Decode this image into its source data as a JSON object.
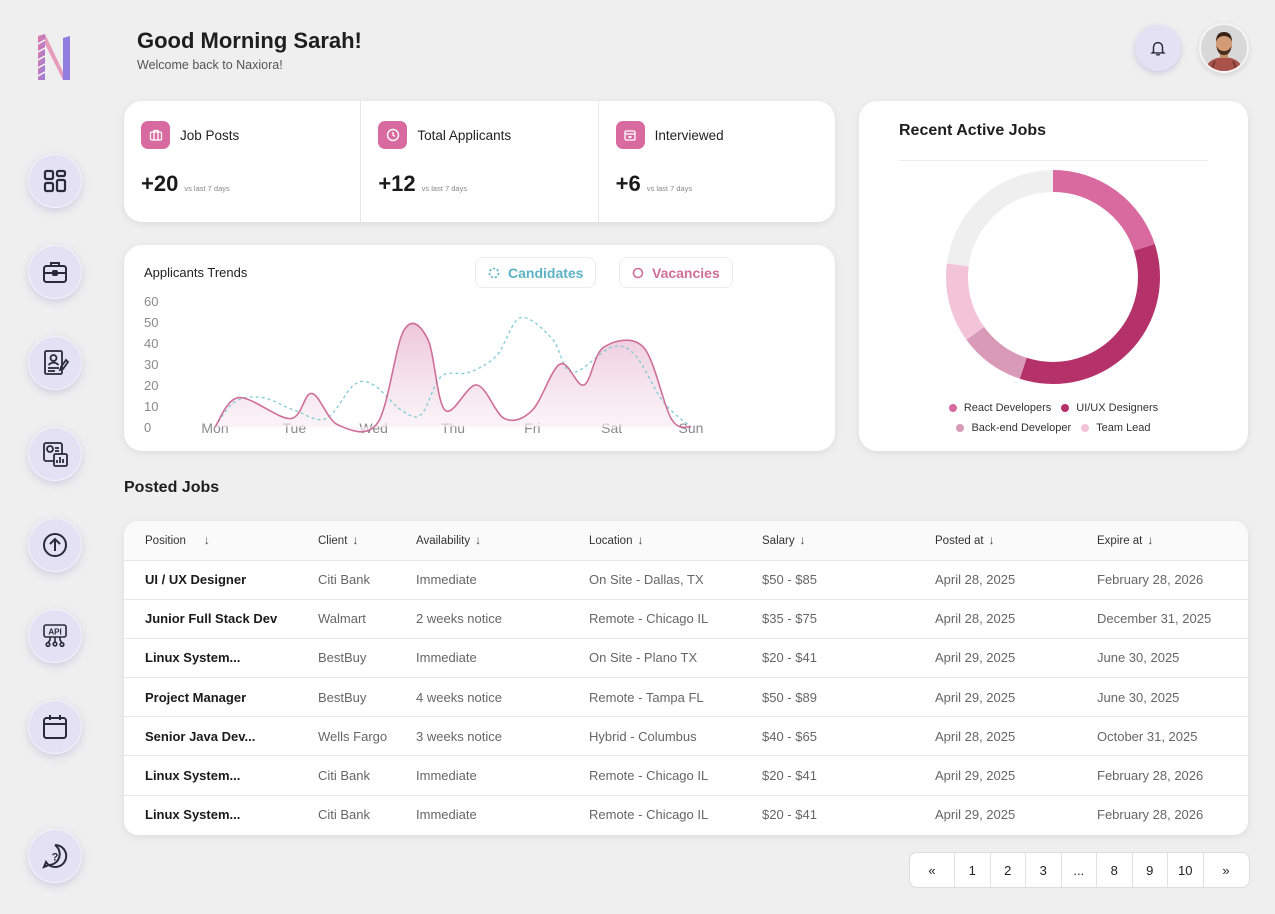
{
  "app": {
    "name": "Naxiora"
  },
  "header": {
    "greeting": "Good Morning Sarah!",
    "subtitle": "Welcome back to Naxiora!"
  },
  "sidebar": {
    "items": [
      {
        "name": "dashboard",
        "icon": "dashboard-grid-icon"
      },
      {
        "name": "jobs",
        "icon": "briefcase-icon"
      },
      {
        "name": "candidates",
        "icon": "resume-profile-icon"
      },
      {
        "name": "reports",
        "icon": "report-chart-icon"
      },
      {
        "name": "upload",
        "icon": "upload-arrow-icon"
      },
      {
        "name": "api",
        "icon": "api-icon"
      },
      {
        "name": "calendar",
        "icon": "calendar-icon"
      }
    ],
    "help_icon": "help-question-icon"
  },
  "stats": [
    {
      "label": "Job Posts",
      "value": "+20",
      "sub": "vs last 7 days",
      "icon": "briefcase-icon"
    },
    {
      "label": "Total Applicants",
      "value": "+12",
      "sub": "vs last 7 days",
      "icon": "clock-icon"
    },
    {
      "label": "Interviewed",
      "value": "+6",
      "sub": "vs last 7 days",
      "icon": "calendar-icon"
    }
  ],
  "trends": {
    "title": "Applicants Trends",
    "candidates_label": "Candidates",
    "vacancies_label": "Vacancies"
  },
  "recent": {
    "title": "Recent Active Jobs",
    "legend": [
      {
        "label": "React Developers",
        "color": "#d96aa0"
      },
      {
        "label": "UI/UX Designers",
        "color": "#b5316a"
      },
      {
        "label": "Back-end Developer",
        "color": "#d99ab8"
      },
      {
        "label": "Team Lead",
        "color": "#f3c3d7"
      }
    ]
  },
  "chart_data": [
    {
      "type": "area",
      "title": "Applicants Trends",
      "categories": [
        "Mon",
        "Tue",
        "Wed",
        "Thu",
        "Fri",
        "Sat",
        "Sun"
      ],
      "y_ticks": [
        0,
        10,
        20,
        30,
        40,
        50,
        60
      ],
      "ylim": [
        0,
        60
      ],
      "series": [
        {
          "name": "Vacancies",
          "color": "#cf6f99",
          "fill": "#ecc3d8",
          "points": [
            [
              0,
              0
            ],
            [
              0.3,
              14
            ],
            [
              0.95,
              4
            ],
            [
              1.22,
              16
            ],
            [
              1.55,
              1
            ],
            [
              2.05,
              2
            ],
            [
              2.38,
              46
            ],
            [
              2.68,
              42
            ],
            [
              2.9,
              8
            ],
            [
              3.3,
              20
            ],
            [
              3.65,
              4
            ],
            [
              4.0,
              8
            ],
            [
              4.35,
              30
            ],
            [
              4.65,
              20
            ],
            [
              4.9,
              38
            ],
            [
              5.4,
              38
            ],
            [
              5.75,
              4
            ],
            [
              6,
              0
            ]
          ]
        },
        {
          "name": "Candidates",
          "color": "#7fcad6",
          "dashed": true,
          "points": [
            [
              0,
              0
            ],
            [
              0.25,
              12
            ],
            [
              0.6,
              14
            ],
            [
              1.0,
              8
            ],
            [
              1.4,
              4
            ],
            [
              1.75,
              20
            ],
            [
              2.0,
              20
            ],
            [
              2.35,
              8
            ],
            [
              2.6,
              6
            ],
            [
              2.85,
              24
            ],
            [
              3.2,
              26
            ],
            [
              3.55,
              34
            ],
            [
              3.85,
              52
            ],
            [
              4.25,
              42
            ],
            [
              4.5,
              26
            ],
            [
              5.0,
              38
            ],
            [
              5.3,
              34
            ],
            [
              5.65,
              12
            ],
            [
              6,
              0
            ]
          ]
        }
      ]
    },
    {
      "type": "pie",
      "title": "Recent Active Jobs",
      "donut": true,
      "slices": [
        {
          "label": "React Developers",
          "value": 20,
          "color": "#d96aa0"
        },
        {
          "label": "UI/UX Designers",
          "value": 35,
          "color": "#b5316a"
        },
        {
          "label": "Back-end Developer",
          "value": 10,
          "color": "#d99ab8"
        },
        {
          "label": "Team Lead",
          "value": 12,
          "color": "#f3c3d7"
        },
        {
          "label": "",
          "value": 23,
          "color": "#efefef"
        }
      ]
    }
  ],
  "posted": {
    "title": "Posted Jobs",
    "columns": [
      "Position",
      "Client",
      "Availability",
      "Location",
      "Salary",
      "Posted at",
      "Expire at"
    ],
    "rows": [
      [
        "UI / UX Designer",
        "Citi Bank",
        "Immediate",
        "On Site - Dallas, TX",
        "$50 - $85",
        "April 28, 2025",
        "February 28, 2026"
      ],
      [
        "Junior Full Stack Dev",
        "Walmart",
        "2 weeks notice",
        "Remote - Chicago IL",
        "$35 - $75",
        "April 28, 2025",
        "December 31, 2025"
      ],
      [
        "Linux System...",
        "BestBuy",
        "Immediate",
        "On Site - Plano TX",
        "$20 - $41",
        "April 29, 2025",
        "June 30, 2025"
      ],
      [
        "Project Manager",
        "BestBuy",
        "4 weeks notice",
        "Remote - Tampa FL",
        "$50 - $89",
        "April 29, 2025",
        "June 30, 2025"
      ],
      [
        "Senior Java Dev...",
        "Wells Fargo",
        "3 weeks notice",
        "Hybrid - Columbus",
        "$40 - $65",
        "April 28, 2025",
        "October 31, 2025"
      ],
      [
        "Linux System...",
        "Citi Bank",
        "Immediate",
        "Remote - Chicago IL",
        "$20 - $41",
        "April 29, 2025",
        "February 28, 2026"
      ],
      [
        "Linux System...",
        "Citi Bank",
        "Immediate",
        "Remote - Chicago IL",
        "$20 - $41",
        "April 29, 2025",
        "February 28, 2026"
      ]
    ]
  },
  "pagination": {
    "first": "«",
    "pages": [
      "1",
      "2",
      "3",
      "...",
      "8",
      "9",
      "10"
    ],
    "last": "»"
  }
}
